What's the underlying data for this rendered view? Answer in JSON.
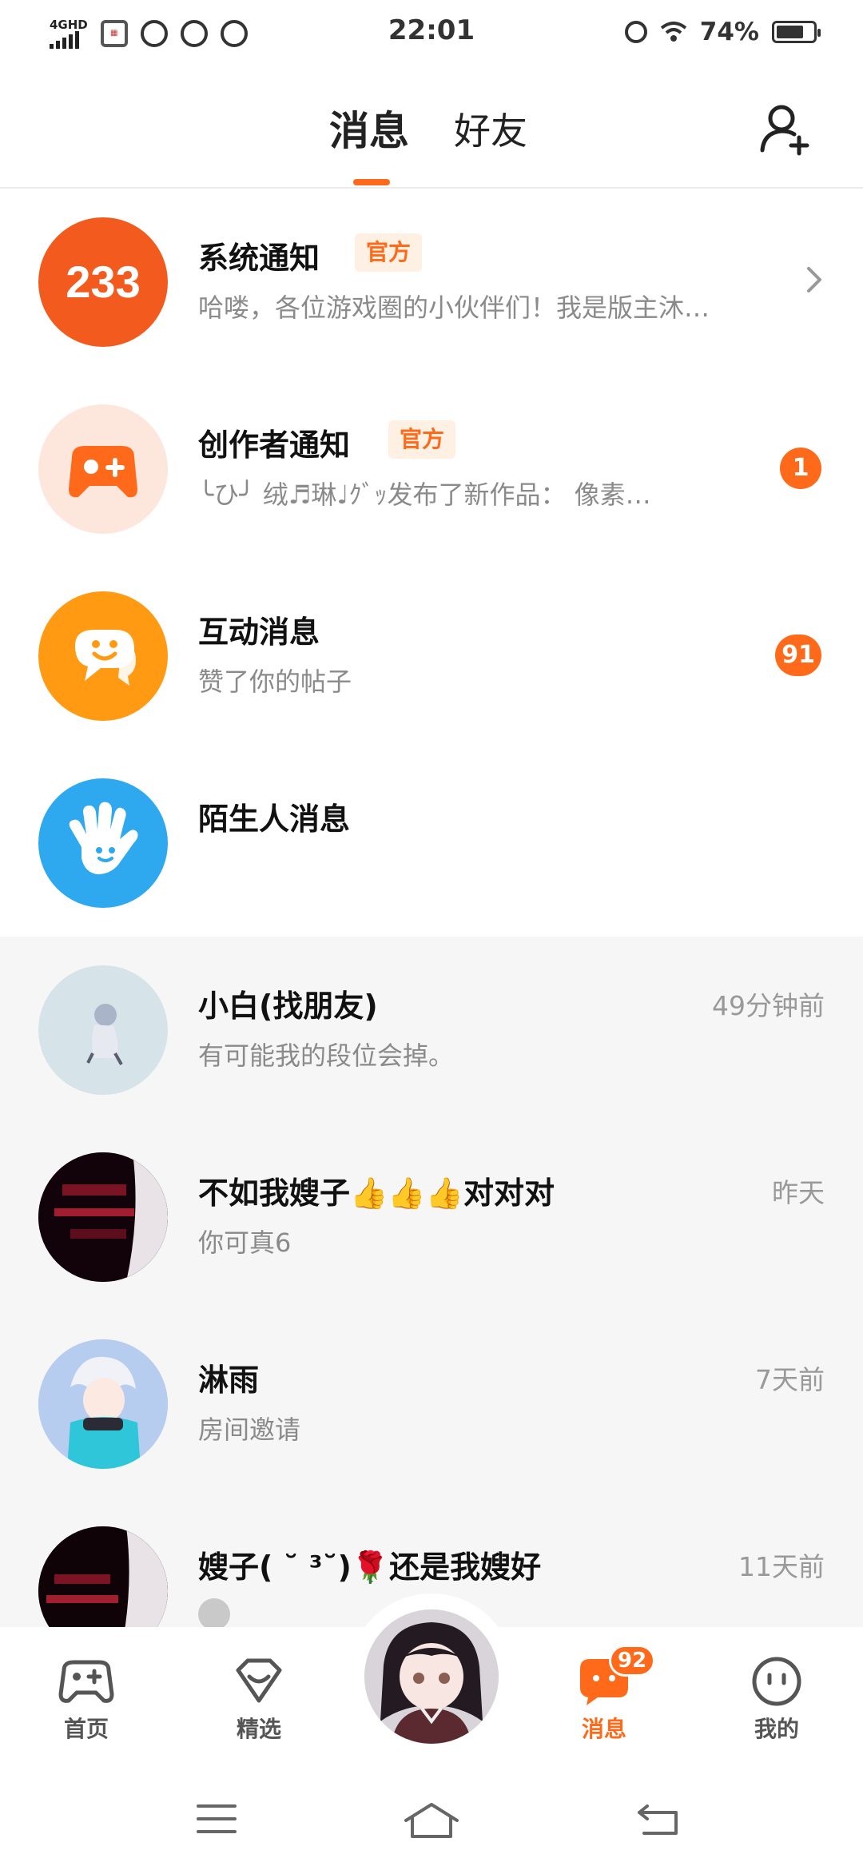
{
  "status_bar": {
    "network": "4GHD",
    "time": "22:01",
    "battery": "74%",
    "battery_level": 0.74
  },
  "header": {
    "tabs": [
      {
        "label": "消息",
        "active": true
      },
      {
        "label": "好友",
        "active": false
      }
    ]
  },
  "system_rows": [
    {
      "title": "系统通知",
      "tag": "官方",
      "subtitle": "哈喽，各位游戏圈的小伙伴们！我是版主沐…",
      "icon_text": "233",
      "icon": "logo-233-icon"
    },
    {
      "title": "创作者通知",
      "tag": "官方",
      "subtitle": "╰ひ╯ 绒♬琳♩ｸﾞｯ发布了新作品：  像素…",
      "badge": "1",
      "icon": "gamepad-icon"
    },
    {
      "title": "互动消息",
      "subtitle": "赞了你的帖子",
      "badge": "91",
      "icon": "chat-smile-icon"
    },
    {
      "title": "陌生人消息",
      "icon": "waving-hand-icon"
    }
  ],
  "chats": [
    {
      "name": "小白(找朋友)",
      "preview": "有可能我的段位会掉。",
      "time": "49分钟前"
    },
    {
      "name": "不如我嫂子👍👍👍对对对",
      "preview": "你可真6",
      "time": "昨天"
    },
    {
      "name": "淋雨",
      "preview": "房间邀请",
      "time": "7天前"
    },
    {
      "name": "嫂子( ˘ ³˘)🌹还是我嫂好",
      "preview": "",
      "time": "11天前"
    }
  ],
  "bottom_nav": {
    "items": [
      {
        "label": "首页",
        "icon": "gamepad-icon",
        "active": false
      },
      {
        "label": "精选",
        "icon": "heart-diamond-icon",
        "active": false
      },
      {
        "label": "消息",
        "icon": "message-icon",
        "active": true,
        "badge": "92"
      },
      {
        "label": "我的",
        "icon": "smiley-face-icon",
        "active": false
      }
    ]
  },
  "colors": {
    "accent": "#ff6a1a",
    "notice_red": "#f25a1e",
    "creator_bg": "#fde6dc",
    "interaction_orange": "#ff9a12",
    "stranger_blue": "#2ea8ee"
  }
}
